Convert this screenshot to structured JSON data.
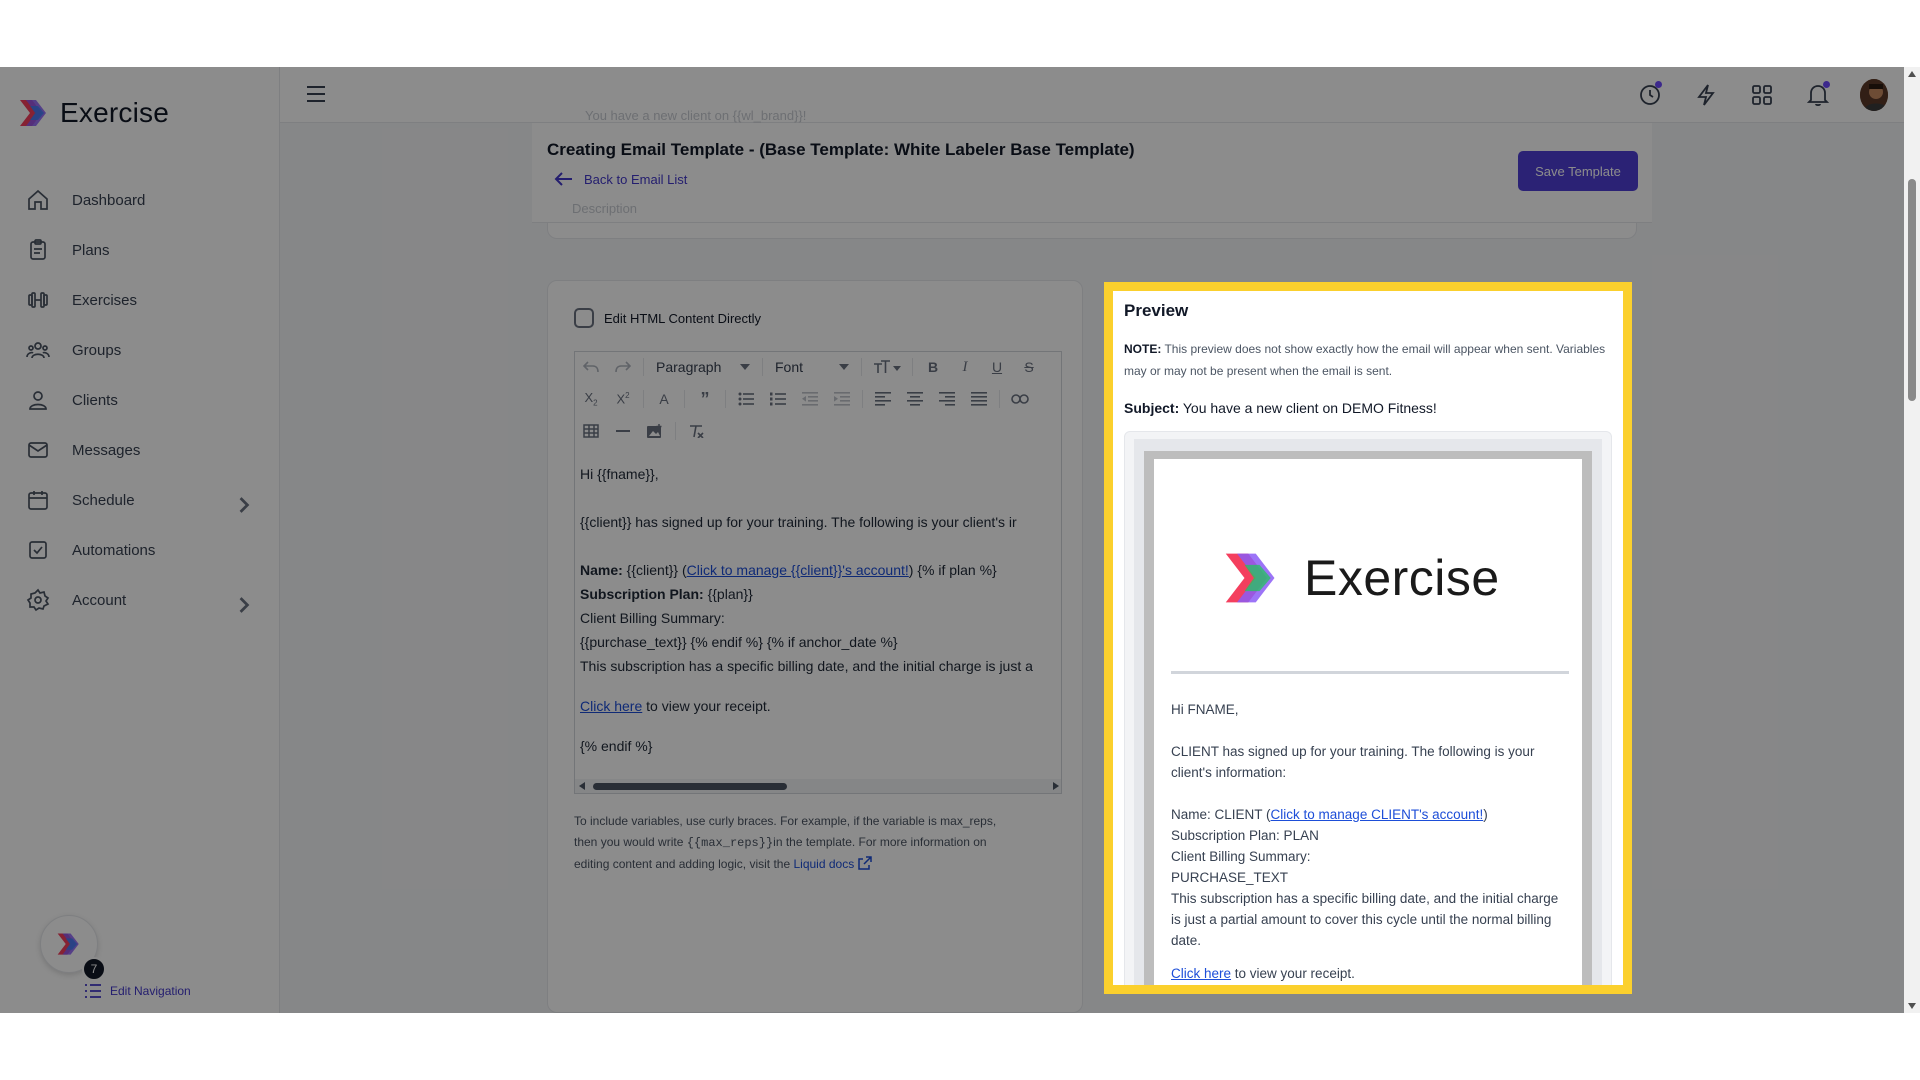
{
  "brand": {
    "name": "Exercise"
  },
  "sidebar": {
    "items": [
      {
        "label": "Dashboard",
        "icon": "home-icon"
      },
      {
        "label": "Plans",
        "icon": "clipboard-icon"
      },
      {
        "label": "Exercises",
        "icon": "dumbbell-icon"
      },
      {
        "label": "Groups",
        "icon": "users-icon"
      },
      {
        "label": "Clients",
        "icon": "user-icon"
      },
      {
        "label": "Messages",
        "icon": "mail-icon"
      },
      {
        "label": "Schedule",
        "icon": "calendar-icon",
        "has_children": true
      },
      {
        "label": "Automations",
        "icon": "checkbox-icon"
      },
      {
        "label": "Account",
        "icon": "gear-icon",
        "has_children": true
      }
    ],
    "edit_nav": {
      "badge": "7",
      "label": "Edit Navigation"
    }
  },
  "topbar": {
    "icons": [
      "history-icon",
      "bolt-icon",
      "apps-grid-icon",
      "bell-icon",
      "avatar"
    ]
  },
  "header": {
    "title": "Creating Email Template - (Base Template: White Labeler Base Template)",
    "back_label": "Back to Email List",
    "save_label": "Save Template",
    "ghost_subject": "You have a new client on {{wl_brand}}!",
    "ghost_description": "Description"
  },
  "editor": {
    "checkbox_label": "Edit HTML Content Directly",
    "paragraph_select": "Paragraph",
    "font_select": "Font",
    "lines": {
      "greeting": "Hi {{fname}},",
      "intro": "{{client}} has signed up for your training. The following is your client's ir",
      "name_label": "Name:",
      "name_value": " {{client}} (",
      "name_link": "Click to manage {{client}}'s account!",
      "name_tail": ") {% if plan %}",
      "plan_label": "Subscription Plan:",
      "plan_value": " {{plan}}",
      "billing": "Client Billing Summary:",
      "purchase": "{{purchase_text}} {% endif %} {% if anchor_date %}",
      "specific": "This subscription has a specific billing date, and the initial charge is just a",
      "click_link": "Click here",
      "click_tail": " to view your receipt.",
      "endif": "{% endif %}"
    },
    "help": {
      "text1": "To include variables, use curly braces. For example, if the variable is max_reps,",
      "text2a": "then you would write ",
      "code": "{{max_reps}}",
      "text2b": "in the template. For more information on",
      "text3": "editing content and adding logic, visit the ",
      "link": "Liquid docs"
    }
  },
  "preview": {
    "title": "Preview",
    "note_label": "NOTE:",
    "note_text": " This preview does not show exactly how the email will appear when sent. Variables may or may not be present when the email is sent.",
    "subject_label": "Subject:",
    "subject_value": " You have a new client on DEMO Fitness!",
    "email": {
      "logo_text": "Exercise",
      "greeting": "Hi FNAME,",
      "intro": "CLIENT has signed up for your training. The following is your client's information:",
      "name_prefix": "Name: CLIENT (",
      "name_link": "Click to manage CLIENT's account!",
      "name_suffix": ")",
      "plan": "Subscription Plan: PLAN",
      "billing": "Client Billing Summary:",
      "purchase": "PURCHASE_TEXT",
      "specific": "This subscription has a specific billing date, and the initial charge is just a partial amount to cover this cycle until the normal billing date.",
      "click_link": "Click here",
      "click_tail": " to view your receipt."
    }
  },
  "colors": {
    "accent": "#4f3fd6",
    "highlight": "#fbd02d",
    "link": "#1d4ed8"
  }
}
